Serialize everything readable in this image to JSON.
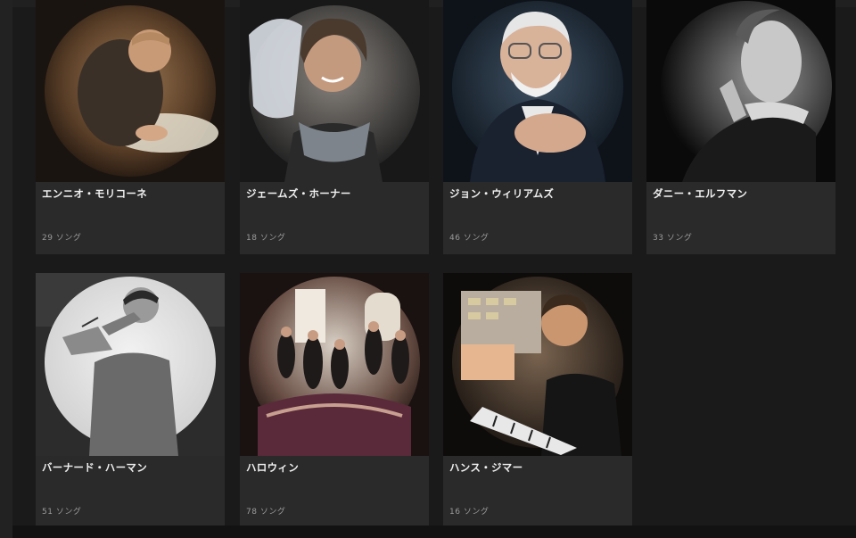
{
  "artists": [
    {
      "name": "エンニオ・モリコーネ",
      "songs": "29 ソング",
      "tone": "#8a6a4a",
      "avatar": "composer-writing-score"
    },
    {
      "name": "ジェームズ・ホーナー",
      "songs": "18 ソング",
      "tone": "#6f6a62",
      "avatar": "smiling-man-scarf"
    },
    {
      "name": "ジョン・ウィリアムズ",
      "songs": "46 ソング",
      "tone": "#3a4a5c",
      "avatar": "bearded-man-glasses"
    },
    {
      "name": "ダニー・エルフマン",
      "songs": "33 ソング",
      "tone": "#777777",
      "avatar": "man-hand-on-chin"
    },
    {
      "name": "バーナード・ハーマン",
      "songs": "51 ソング",
      "tone": "#b8b8b8",
      "avatar": "conductor-bw"
    },
    {
      "name": "ハロウィン",
      "songs": "78 ソング",
      "tone": "#6a4a4a",
      "avatar": "band-on-staircase"
    },
    {
      "name": "ハンス・ジマー",
      "songs": "16 ソング",
      "tone": "#5a4a3a",
      "avatar": "man-at-synthesizer"
    }
  ]
}
